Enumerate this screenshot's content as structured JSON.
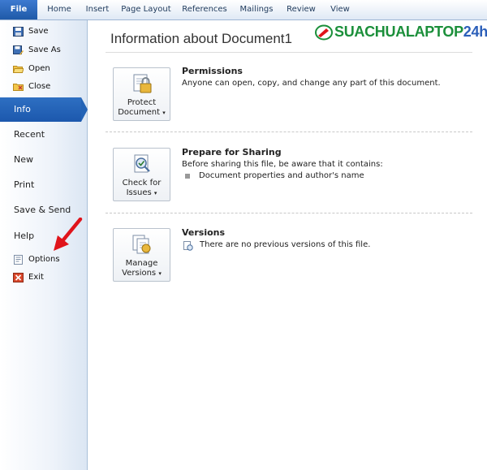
{
  "ribbon": {
    "tabs": [
      "File",
      "Home",
      "Insert",
      "Page Layout",
      "References",
      "Mailings",
      "Review",
      "View"
    ]
  },
  "backstage": {
    "commands": [
      {
        "label": "Save",
        "icon": "save-icon"
      },
      {
        "label": "Save As",
        "icon": "save-as-icon"
      },
      {
        "label": "Open",
        "icon": "open-folder-icon"
      },
      {
        "label": "Close",
        "icon": "close-folder-icon"
      }
    ],
    "nav": [
      {
        "label": "Info",
        "active": true
      },
      {
        "label": "Recent"
      },
      {
        "label": "New"
      },
      {
        "label": "Print"
      },
      {
        "label": "Save & Send"
      },
      {
        "label": "Help"
      }
    ],
    "bottom_commands": [
      {
        "label": "Options",
        "icon": "options-icon"
      },
      {
        "label": "Exit",
        "icon": "exit-icon"
      }
    ]
  },
  "main": {
    "title": "Information about Document1",
    "watermark": {
      "brand": "SUACHUALAPTOP",
      "suffix": "24h"
    },
    "sections": [
      {
        "button_line1": "Protect",
        "button_line2": "Document",
        "heading": "Permissions",
        "text": "Anyone can open, copy, and change any part of this document."
      },
      {
        "button_line1": "Check for",
        "button_line2": "Issues",
        "heading": "Prepare for Sharing",
        "text": "Before sharing this file, be aware that it contains:",
        "bullet": "Document properties and author's name"
      },
      {
        "button_line1": "Manage",
        "button_line2": "Versions",
        "heading": "Versions",
        "text": "There are no previous versions of this file."
      }
    ]
  },
  "colors": {
    "accent": "#2363b6",
    "annotation_arrow": "#e0141b"
  }
}
